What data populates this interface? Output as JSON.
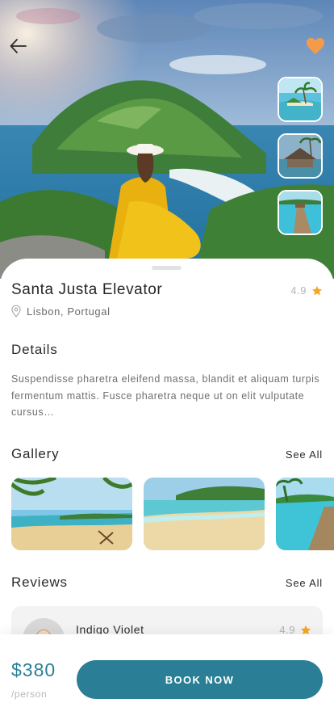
{
  "colors": {
    "accent": "#2a7f96",
    "heart": "#f39b4b",
    "star": "#f5a623"
  },
  "header": {
    "back_icon": "arrow-left-icon",
    "favorite_icon": "heart-icon",
    "favorited": true
  },
  "place": {
    "title": "Santa Justa Elevator",
    "rating": "4.9",
    "location": "Lisbon, Portugal"
  },
  "details": {
    "heading": "Details",
    "text": "Suspendisse pharetra eleifend massa, blandit et aliquam turpis fermentum mattis. Fusce pharetra neque ut on elit vulputate cursus…"
  },
  "gallery": {
    "heading": "Gallery",
    "see_all": "See All"
  },
  "reviews": {
    "heading": "Reviews",
    "see_all": "See All",
    "items": [
      {
        "name": "Indigo Violet",
        "rating": "4.9"
      }
    ]
  },
  "booking": {
    "price": "$380",
    "unit": "/person",
    "button": "BOOK NOW"
  }
}
